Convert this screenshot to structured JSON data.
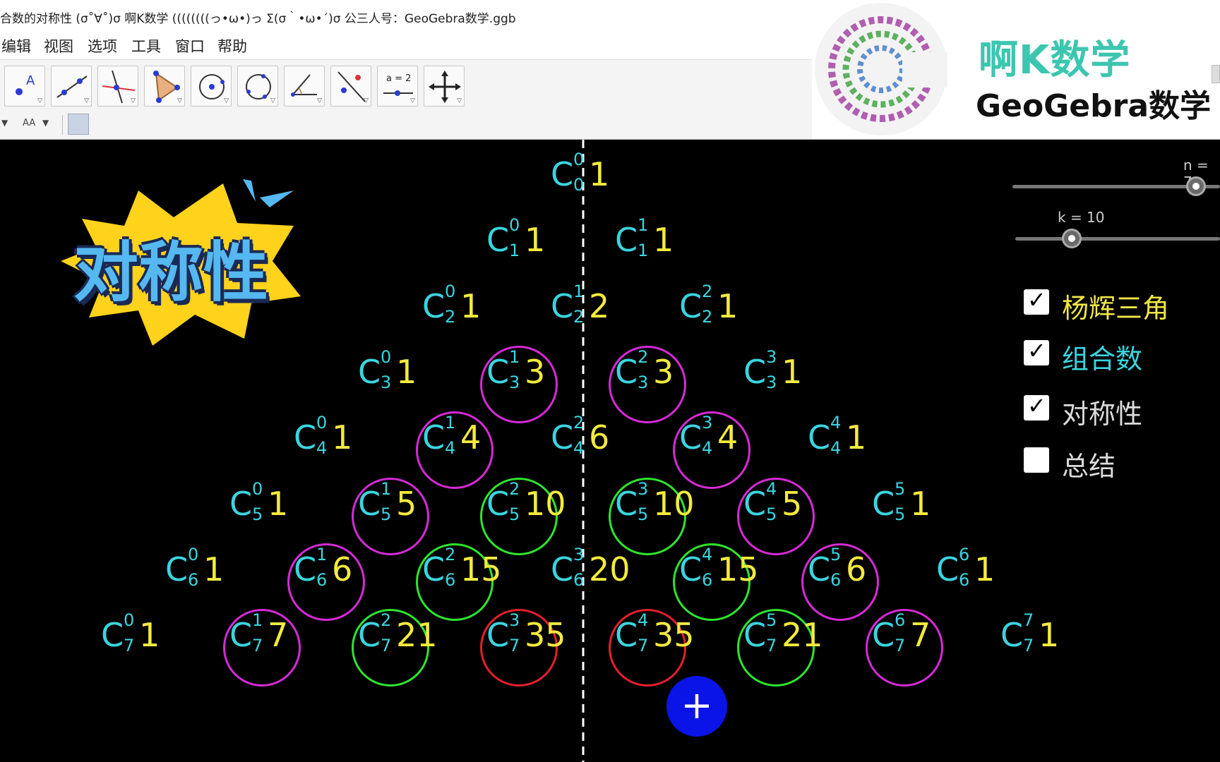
{
  "window": {
    "title": "合数的对称性 (σ˚∀˚)σ  啊K数学    ((((((((っ•ω•)っ Σ(σ｀•ω•´)σ  公三人号：GeoGebra数学.ggb",
    "minimize_glyph": "—"
  },
  "menu": [
    "编辑",
    "视图",
    "选项",
    "工具",
    "窗口",
    "帮助"
  ],
  "toolbar": {
    "tools": [
      {
        "name": "point-tool-icon"
      },
      {
        "name": "line-tool-icon"
      },
      {
        "name": "perpendicular-line-tool-icon"
      },
      {
        "name": "polygon-tool-icon"
      },
      {
        "name": "circle-center-point-tool-icon"
      },
      {
        "name": "circle-three-points-tool-icon"
      },
      {
        "name": "angle-tool-icon"
      },
      {
        "name": "reflect-tool-icon"
      },
      {
        "name": "slider-tool-icon",
        "text": "a = 2"
      },
      {
        "name": "move-graphics-view-tool-icon"
      }
    ]
  },
  "stylebar": {
    "font_size_label": "AA"
  },
  "logo": {
    "brand_name": "啊K数学",
    "brand_sub": "GeoGebra数学"
  },
  "overlay": {
    "badge_text": "对称性",
    "add_button": "+"
  },
  "sliders": [
    {
      "label": "n = 7",
      "value": 7
    },
    {
      "label": "k = 10",
      "value": 10
    }
  ],
  "checkboxes": [
    {
      "label": "杨辉三角",
      "checked": true,
      "color": "#f0e645"
    },
    {
      "label": "组合数",
      "checked": true,
      "color": "#3ad5e0"
    },
    {
      "label": "对称性",
      "checked": true,
      "color": "#dcdcdc"
    },
    {
      "label": "总结",
      "checked": false,
      "color": "#dcdcdc"
    }
  ],
  "colors": {
    "combination": "#3ad5e0",
    "value": "#f3ea3e",
    "ring_magenta": "#d62ad6",
    "ring_green": "#2ee52e",
    "ring_red": "#e3202a",
    "axis": "#ffffff"
  },
  "triangle": {
    "symbol": "C",
    "rows": [
      [
        {
          "k": 0,
          "n": 0,
          "v": "1"
        }
      ],
      [
        {
          "k": 0,
          "n": 1,
          "v": "1"
        },
        {
          "k": 1,
          "n": 1,
          "v": "1"
        }
      ],
      [
        {
          "k": 0,
          "n": 2,
          "v": "1"
        },
        {
          "k": 1,
          "n": 2,
          "v": "2"
        },
        {
          "k": 2,
          "n": 2,
          "v": "1"
        }
      ],
      [
        {
          "k": 0,
          "n": 3,
          "v": "1"
        },
        {
          "k": 1,
          "n": 3,
          "v": "3",
          "ring": "magenta"
        },
        {
          "k": 2,
          "n": 3,
          "v": "3",
          "ring": "magenta"
        },
        {
          "k": 3,
          "n": 3,
          "v": "1"
        }
      ],
      [
        {
          "k": 0,
          "n": 4,
          "v": "1"
        },
        {
          "k": 1,
          "n": 4,
          "v": "4",
          "ring": "magenta"
        },
        {
          "k": 2,
          "n": 4,
          "v": "6"
        },
        {
          "k": 3,
          "n": 4,
          "v": "4",
          "ring": "magenta"
        },
        {
          "k": 4,
          "n": 4,
          "v": "1"
        }
      ],
      [
        {
          "k": 0,
          "n": 5,
          "v": "1"
        },
        {
          "k": 1,
          "n": 5,
          "v": "5",
          "ring": "magenta"
        },
        {
          "k": 2,
          "n": 5,
          "v": "10",
          "ring": "green"
        },
        {
          "k": 3,
          "n": 5,
          "v": "10",
          "ring": "green"
        },
        {
          "k": 4,
          "n": 5,
          "v": "5",
          "ring": "magenta"
        },
        {
          "k": 5,
          "n": 5,
          "v": "1"
        }
      ],
      [
        {
          "k": 0,
          "n": 6,
          "v": "1"
        },
        {
          "k": 1,
          "n": 6,
          "v": "6",
          "ring": "magenta"
        },
        {
          "k": 2,
          "n": 6,
          "v": "15",
          "ring": "green"
        },
        {
          "k": 3,
          "n": 6,
          "v": "20"
        },
        {
          "k": 4,
          "n": 6,
          "v": "15",
          "ring": "green"
        },
        {
          "k": 5,
          "n": 6,
          "v": "6",
          "ring": "magenta"
        },
        {
          "k": 6,
          "n": 6,
          "v": "1"
        }
      ],
      [
        {
          "k": 0,
          "n": 7,
          "v": "1"
        },
        {
          "k": 1,
          "n": 7,
          "v": "7",
          "ring": "magenta"
        },
        {
          "k": 2,
          "n": 7,
          "v": "21",
          "ring": "green"
        },
        {
          "k": 3,
          "n": 7,
          "v": "35",
          "ring": "red"
        },
        {
          "k": 4,
          "n": 7,
          "v": "35",
          "ring": "red"
        },
        {
          "k": 5,
          "n": 7,
          "v": "21",
          "ring": "green"
        },
        {
          "k": 6,
          "n": 7,
          "v": "7",
          "ring": "magenta"
        },
        {
          "k": 7,
          "n": 7,
          "v": "1"
        }
      ]
    ]
  }
}
